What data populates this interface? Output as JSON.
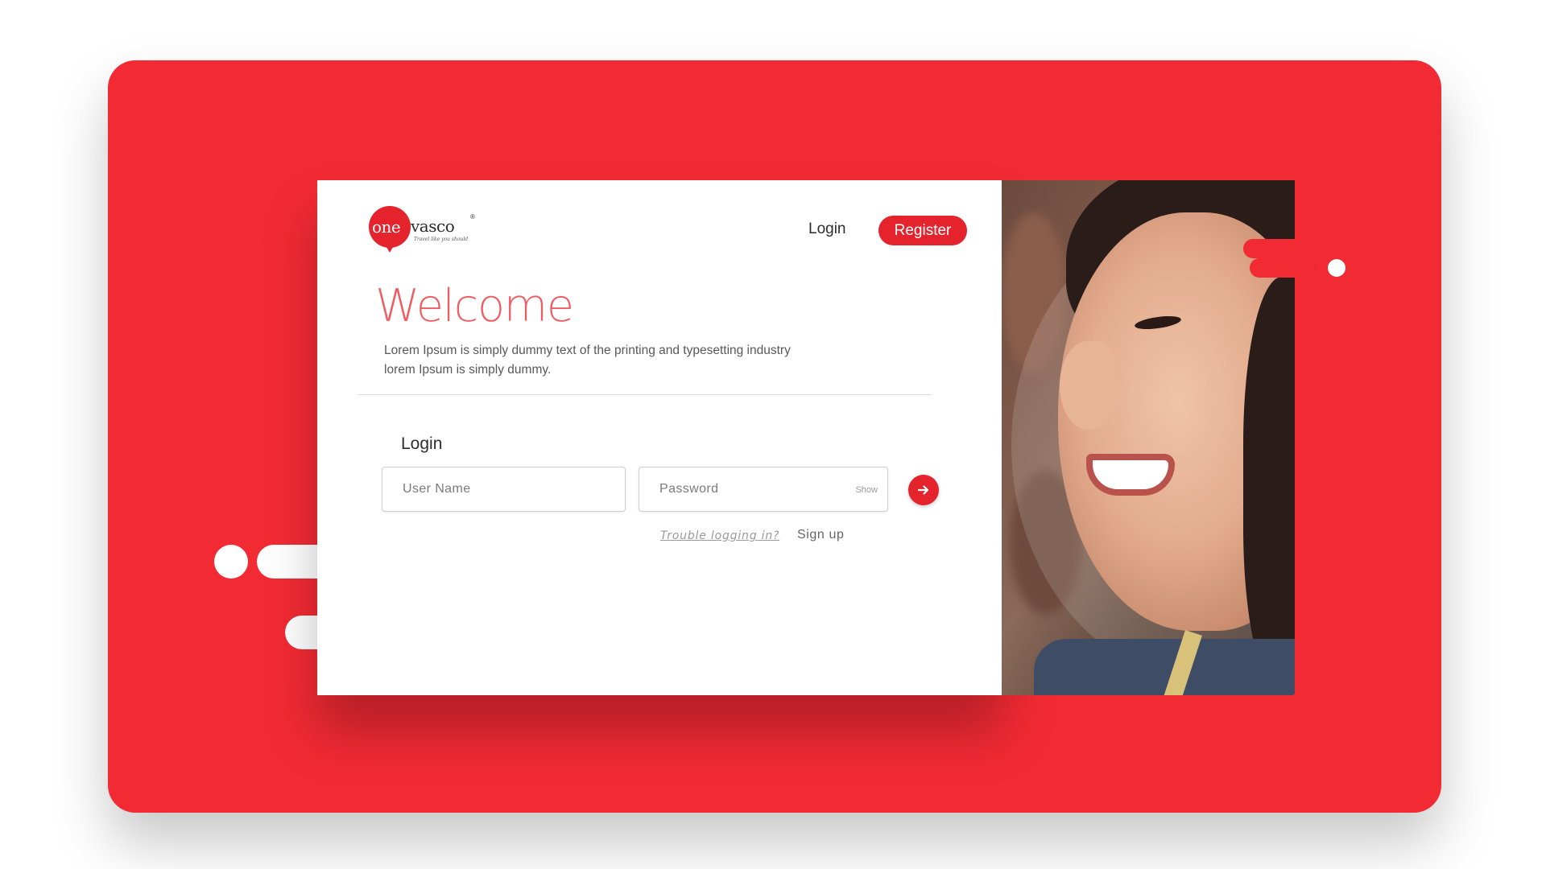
{
  "brand": {
    "logo_word_one": "one",
    "logo_word_two": "vasco",
    "logo_registered": "®",
    "tagline": "Travel like you should",
    "accent_color": "#e5232c",
    "background_color": "#f22a33"
  },
  "nav": {
    "login_label": "Login",
    "register_label": "Register"
  },
  "hero": {
    "title": "Welcome",
    "description_line1": "Lorem Ipsum is simply dummy text of the printing and typesetting industry",
    "description_line2": "lorem Ipsum is simply dummy."
  },
  "login_form": {
    "title": "Login",
    "username_placeholder": "User Name",
    "password_placeholder": "Password",
    "show_label": "Show",
    "submit_icon": "arrow-right-icon",
    "trouble_label": "Trouble logging in?",
    "signup_label": "Sign up"
  },
  "photo": {
    "icon": "portrait-photo"
  }
}
